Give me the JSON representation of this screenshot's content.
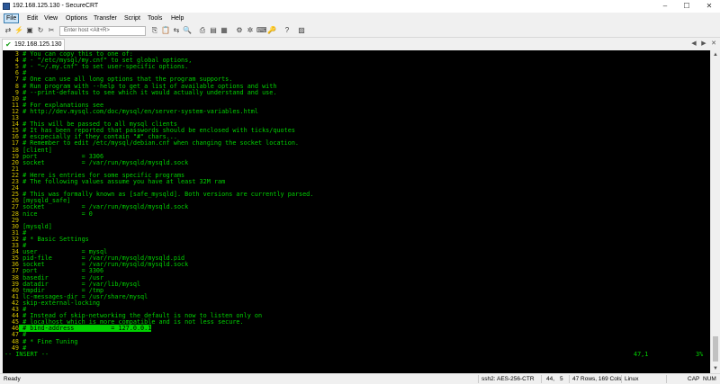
{
  "window": {
    "title": "192.168.125.130 - SecureCRT",
    "minimize": "–",
    "maximize": "☐",
    "close": "✕"
  },
  "menu": [
    "File",
    "Edit",
    "View",
    "Options",
    "Transfer",
    "Script",
    "Tools",
    "Help"
  ],
  "toolbar": {
    "host_placeholder": "Enter host <Alt+R>"
  },
  "tab": {
    "label": "192.168.125.130"
  },
  "terminal": {
    "lines": [
      {
        "n": "3",
        "t": " # You can copy this to one of:"
      },
      {
        "n": "4",
        "t": " # - \"/etc/mysql/my.cnf\" to set global options,"
      },
      {
        "n": "5",
        "t": " # - \"~/.my.cnf\" to set user-specific options."
      },
      {
        "n": "6",
        "t": " #"
      },
      {
        "n": "7",
        "t": " # One can use all long options that the program supports."
      },
      {
        "n": "8",
        "t": " # Run program with --help to get a list of available options and with"
      },
      {
        "n": "9",
        "t": " # --print-defaults to see which it would actually understand and use."
      },
      {
        "n": "10",
        "t": " #"
      },
      {
        "n": "11",
        "t": " # For explanations see"
      },
      {
        "n": "12",
        "t": " # http://dev.mysql.com/doc/mysql/en/server-system-variables.html"
      },
      {
        "n": "13",
        "t": ""
      },
      {
        "n": "14",
        "t": " # This will be passed to all mysql clients"
      },
      {
        "n": "15",
        "t": " # It has been reported that passwords should be enclosed with ticks/quotes"
      },
      {
        "n": "16",
        "t": " # escpecially if they contain \"#\" chars..."
      },
      {
        "n": "17",
        "t": " # Remember to edit /etc/mysql/debian.cnf when changing the socket location."
      },
      {
        "n": "18",
        "t": " [client]"
      },
      {
        "n": "19",
        "t": " port            = 3306"
      },
      {
        "n": "20",
        "t": " socket          = /var/run/mysqld/mysqld.sock"
      },
      {
        "n": "21",
        "t": ""
      },
      {
        "n": "22",
        "t": " # Here is entries for some specific programs"
      },
      {
        "n": "23",
        "t": " # The following values assume you have at least 32M ram"
      },
      {
        "n": "24",
        "t": ""
      },
      {
        "n": "25",
        "t": " # This was formally known as [safe_mysqld]. Both versions are currently parsed."
      },
      {
        "n": "26",
        "t": " [mysqld_safe]"
      },
      {
        "n": "27",
        "t": " socket          = /var/run/mysqld/mysqld.sock"
      },
      {
        "n": "28",
        "t": " nice            = 0"
      },
      {
        "n": "29",
        "t": ""
      },
      {
        "n": "30",
        "t": " [mysqld]"
      },
      {
        "n": "31",
        "t": " #"
      },
      {
        "n": "32",
        "t": " # * Basic Settings"
      },
      {
        "n": "33",
        "t": " #"
      },
      {
        "n": "34",
        "t": " user            = mysql"
      },
      {
        "n": "35",
        "t": " pid-file        = /var/run/mysqld/mysqld.pid"
      },
      {
        "n": "36",
        "t": " socket          = /var/run/mysqld/mysqld.sock"
      },
      {
        "n": "37",
        "t": " port            = 3306"
      },
      {
        "n": "38",
        "t": " basedir         = /usr"
      },
      {
        "n": "39",
        "t": " datadir         = /var/lib/mysql"
      },
      {
        "n": "40",
        "t": " tmpdir          = /tmp"
      },
      {
        "n": "41",
        "t": " lc-messages-dir = /usr/share/mysql"
      },
      {
        "n": "42",
        "t": " skip-external-locking"
      },
      {
        "n": "43",
        "t": " #"
      },
      {
        "n": "44",
        "t": " # Instead of skip-networking the default is now to listen only on"
      },
      {
        "n": "45",
        "t": " # localhost which is more compatible and is not less secure."
      },
      {
        "n": "46",
        "t": " # bind-address          = 127.0.0.1",
        "hl": true
      },
      {
        "n": "47",
        "t": " #"
      },
      {
        "n": "48",
        "t": " # * Fine Tuning"
      },
      {
        "n": "49",
        "t": " #"
      }
    ],
    "mode_line": "-- INSERT --",
    "cursor_pos": "47,1",
    "percent": "3%"
  },
  "status": {
    "ready": "Ready",
    "cipher": "ssh2: AES-256-CTR",
    "row": "44,",
    "col": "5",
    "size": "47 Rows, 169 Cols",
    "os": "Linux",
    "cap": "CAP",
    "num": "NUM"
  }
}
